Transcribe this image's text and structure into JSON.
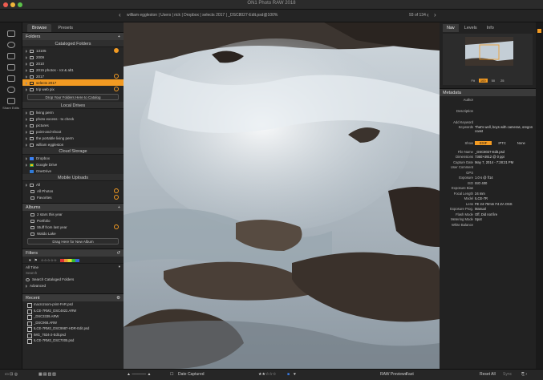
{
  "window": {
    "title": "ON1 Photo RAW 2018"
  },
  "pathbar": {
    "path": "william eggleston | Users | rick | Dropbox | selects 2017 | _DSC8027-Edit.psd@100%",
    "count": "93 of 134"
  },
  "leftbar": {
    "items": [
      "Browse",
      "Develop",
      "Effects",
      "Layers",
      "Resize"
    ],
    "label": "Share Edits"
  },
  "browse": {
    "tabs": [
      "Browse",
      "Presets"
    ],
    "folders_title": "Folders",
    "cataloged_title": "Cataloged Folders",
    "cataloged": [
      "13105",
      "2009",
      "2010",
      "2015 photos - rot & alt1",
      "2017",
      "selects 2017",
      "trip web pix"
    ],
    "drop_folders": "Drop Your Folders Here to Catalog",
    "local_title": "Local Drives",
    "local": [
      "living perm",
      "photo excess - to check",
      "pictures",
      "point-and-shoot",
      "the portable living perm",
      "william eggleston"
    ],
    "cloud_title": "Cloud Storage",
    "cloud": [
      "Dropbox",
      "Google Drive",
      "OneDrive"
    ],
    "mobile_title": "Mobile Uploads",
    "mobile": [
      "All",
      "All Photos",
      "Favorites"
    ]
  },
  "albums": {
    "title": "Albums",
    "items": [
      "2 stars this year",
      "Portfolio",
      "Stuff from last year",
      "Waldo Lake"
    ],
    "drop": "Drag Here for New Album"
  },
  "filters": {
    "title": "Filters",
    "time": "All Time",
    "search_placeholder": "Search",
    "search_cataloged": "Search Cataloged Folders",
    "advanced": "Advanced"
  },
  "recent": {
    "title": "Recent",
    "items": [
      "macrozoom-print-FAR.psd",
      "ILCE-7RM2_DSC4822.ARW",
      "_DSC3339.ARW",
      "_DSC968.ARW",
      "ILCE-7RM2_DSC9987-HDR-Edit.psd",
      "IMG_7634-2-Edit.psd",
      "ILCE-7RM2_DSC7005.psd"
    ]
  },
  "right": {
    "tabs": [
      "Nav",
      "Levels",
      "Info"
    ],
    "zooms": [
      "Fit",
      "100",
      "50",
      "25"
    ],
    "metadata_title": "Metadata",
    "meta_top": [
      {
        "k": "Author",
        "v": ""
      },
      {
        "k": "Description",
        "v": ""
      },
      {
        "k": "Add Keyword",
        "v": ""
      },
      {
        "k": "Keywords",
        "v": "That's well, boys with cameras, oregon coast"
      }
    ],
    "show_label": "Show",
    "show_tabs": [
      "EXIF",
      "IPTC",
      "None"
    ],
    "exif": [
      {
        "k": "File Name",
        "v": "_DSC8027-Edit.psd"
      },
      {
        "k": "Dimensions",
        "v": "7360×4912 @ 0 ppi"
      },
      {
        "k": "Capture Date",
        "v": "May 7, 2014 - 7:28:21 PM"
      },
      {
        "k": "User Comment",
        "v": ""
      },
      {
        "k": "GPS",
        "v": ""
      },
      {
        "k": "Exposure",
        "v": "1.0 s @ f/14"
      },
      {
        "k": "ISO",
        "v": "ISO 400"
      },
      {
        "k": "Exposure Bias",
        "v": ""
      },
      {
        "k": "Focal Length",
        "v": "24 mm"
      },
      {
        "k": "Model",
        "v": "ILCE-7R"
      },
      {
        "k": "Lens",
        "v": "FE 24-70mm F4 ZA OSS"
      },
      {
        "k": "Exposure Prog.",
        "v": "Manual"
      },
      {
        "k": "Flash Mode",
        "v": "Off, Did not fire"
      },
      {
        "k": "Metering Mode",
        "v": "Spot"
      },
      {
        "k": "White Balance",
        "v": ""
      }
    ]
  },
  "bottombar": {
    "sort": "Date Captured",
    "raw_label": "RAW Previews:",
    "raw_value": "Fast",
    "reset": "Reset All",
    "sync": "Sync"
  },
  "colors": {
    "accent": "#f29a22"
  }
}
